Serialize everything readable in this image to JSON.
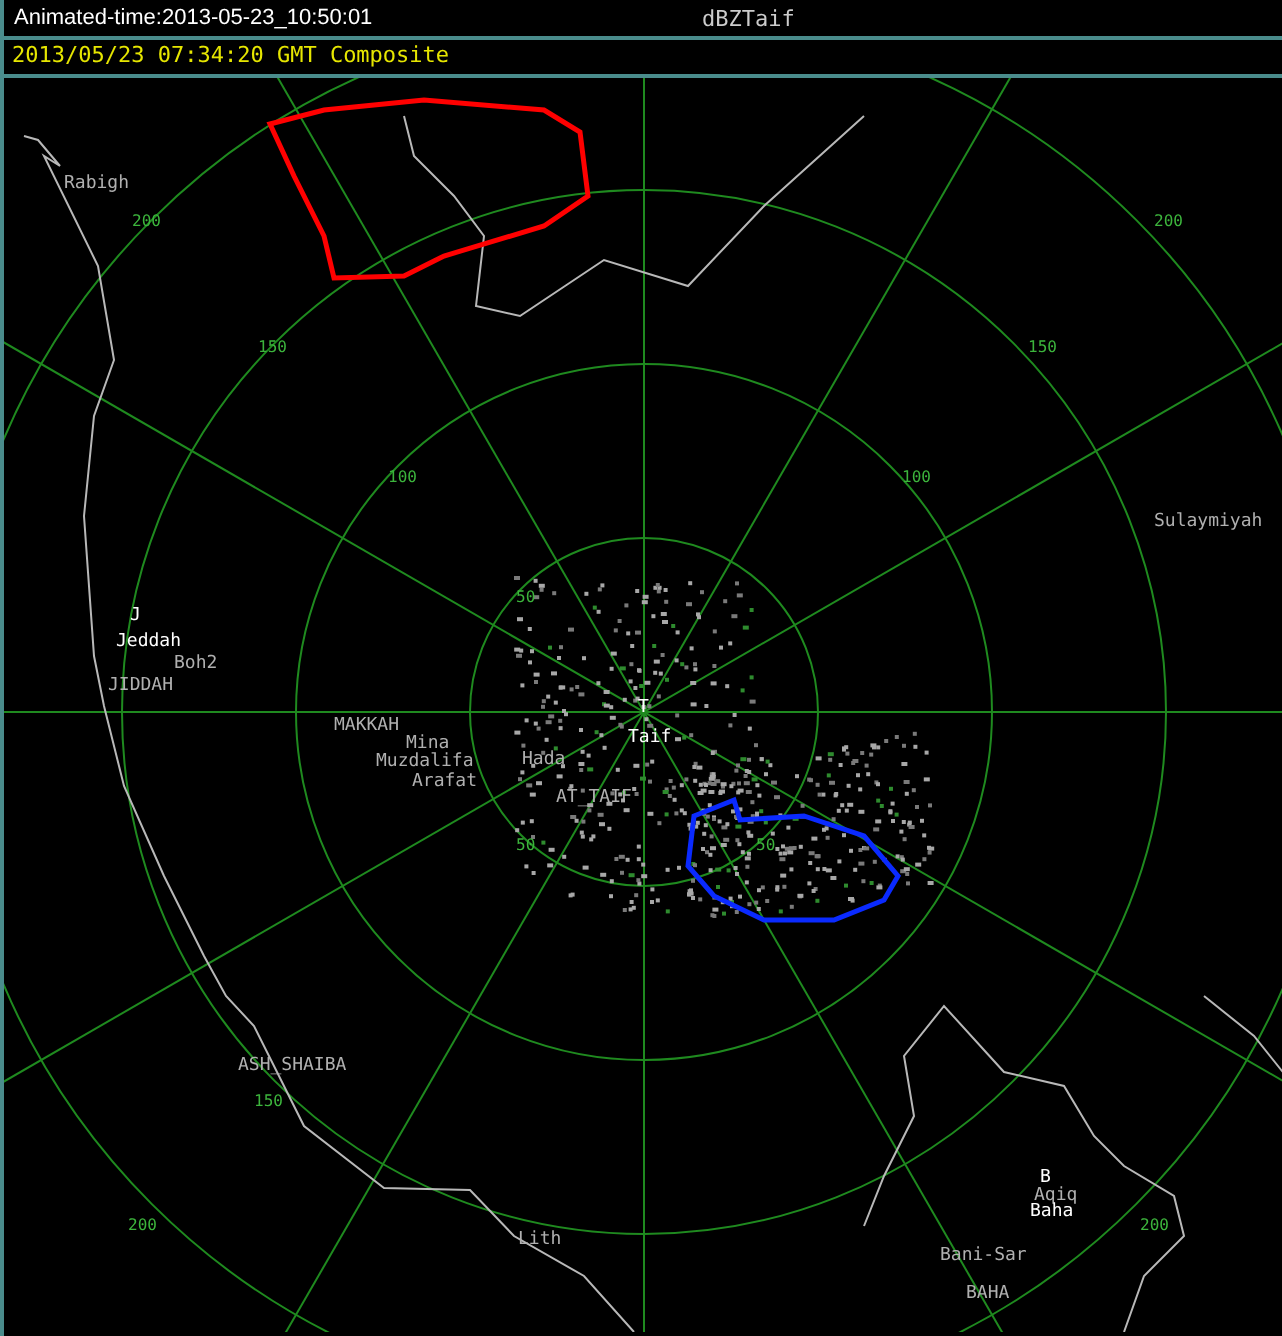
{
  "header": {
    "animated_time": "Animated-time:2013-05-23_10:50:01",
    "product": "dBZTaif"
  },
  "subtitle": "2013/05/23 07:34:20 GMT Composite",
  "range_labels": [
    {
      "text": "200"
    },
    {
      "text": "200"
    },
    {
      "text": "150"
    },
    {
      "text": "150"
    },
    {
      "text": "100"
    },
    {
      "text": "100"
    },
    {
      "text": "50"
    },
    {
      "text": "50"
    },
    {
      "text": "50"
    },
    {
      "text": "150"
    },
    {
      "text": "200"
    },
    {
      "text": "200"
    }
  ],
  "places": [
    {
      "name": "Rabigh",
      "major": false
    },
    {
      "name": "J",
      "major": true
    },
    {
      "name": "Jeddah",
      "major": true
    },
    {
      "name": "Boh2",
      "major": false
    },
    {
      "name": "JIDDAH",
      "major": false
    },
    {
      "name": "MAKKAH",
      "major": false
    },
    {
      "name": "Mina",
      "major": false
    },
    {
      "name": "Muzdalifa",
      "major": false
    },
    {
      "name": "Arafat",
      "major": false
    },
    {
      "name": "Hada",
      "major": false
    },
    {
      "name": "T",
      "major": true
    },
    {
      "name": "Taif",
      "major": true
    },
    {
      "name": "AT_TAIF",
      "major": false
    },
    {
      "name": "Sulaymiyah",
      "major": false
    },
    {
      "name": "ASH_SHAIBA",
      "major": false
    },
    {
      "name": "Lith",
      "major": false
    },
    {
      "name": "B",
      "major": true
    },
    {
      "name": "Aqiq",
      "major": false
    },
    {
      "name": "Baha",
      "major": true
    },
    {
      "name": "Bani-Sar",
      "major": false
    },
    {
      "name": "BAHA",
      "major": false
    }
  ]
}
